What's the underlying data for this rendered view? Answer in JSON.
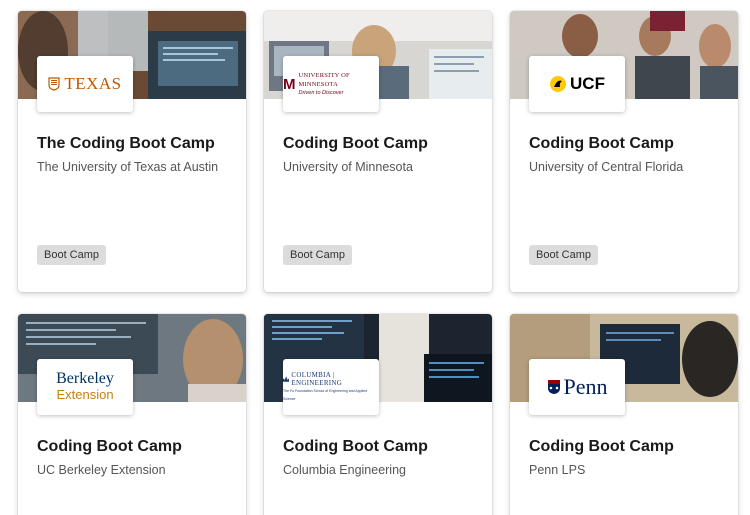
{
  "badge_label": "Boot Camp",
  "colors": {
    "badge_bg": "#dcdcdc",
    "texas_orange": "#bf5700",
    "umn_maroon": "#7a0019",
    "ucf_gold": "#ffc904",
    "berkeley_blue": "#003262",
    "berkeley_gold": "#c4820e",
    "columbia_blue": "#1d3a78",
    "penn_blue": "#011f5b"
  },
  "cards": [
    {
      "title": "The Coding Boot Camp",
      "university": "The University of Texas at Austin",
      "logo_text": "TEXAS",
      "logo_icon": "longhorn-seal-icon",
      "badge": "Boot Camp"
    },
    {
      "title": "Coding Boot Camp",
      "university": "University of Minnesota",
      "logo_text": "UNIVERSITY OF MINNESOTA",
      "logo_tagline": "Driven to Discover",
      "logo_icon": "umn-m-icon",
      "badge": "Boot Camp"
    },
    {
      "title": "Coding Boot Camp",
      "university": "University of Central Florida",
      "logo_text": "UCF",
      "logo_icon": "pegasus-icon",
      "badge": "Boot Camp"
    },
    {
      "title": "Coding Boot Camp",
      "university": "UC Berkeley Extension",
      "logo_text": "Berkeley",
      "logo_subtext": "Extension"
    },
    {
      "title": "Coding Boot Camp",
      "university": "Columbia Engineering",
      "logo_text": "COLUMBIA | ENGINEERING",
      "logo_subtext": "The Fu Foundation School of Engineering and Applied Science",
      "logo_icon": "crown-icon"
    },
    {
      "title": "Coding Boot Camp",
      "university": "Penn LPS",
      "logo_text": "Penn",
      "logo_icon": "penn-shield-icon"
    }
  ]
}
